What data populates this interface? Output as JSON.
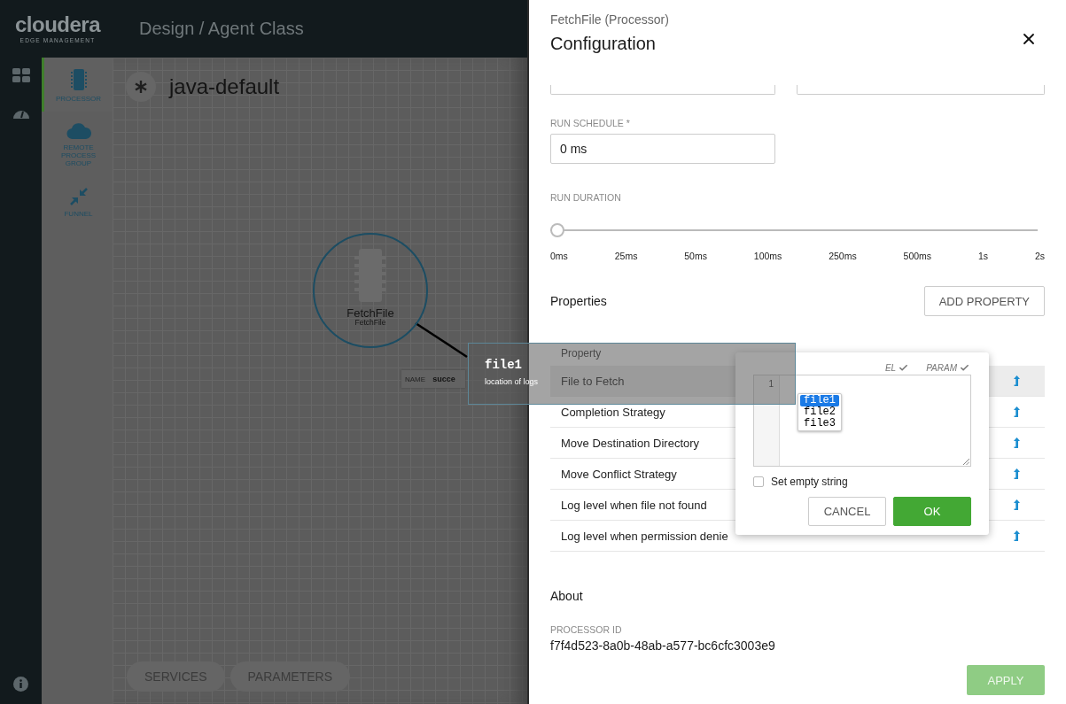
{
  "app": {
    "logo": "cloudera",
    "logo_sub": "EDGE MANAGEMENT",
    "breadcrumb": "Design / Agent Class"
  },
  "palette": [
    {
      "kind": "processor",
      "label": "PROCESSOR",
      "selected": true
    },
    {
      "kind": "remote",
      "label": "REMOTE PROCESS GROUP",
      "selected": false
    },
    {
      "kind": "funnel",
      "label": "FUNNEL",
      "selected": false
    }
  ],
  "flow": {
    "name": "java-default"
  },
  "node": {
    "name": "FetchFile",
    "type": "FetchFile"
  },
  "connection": {
    "label": "NAME",
    "name": "succe"
  },
  "canvas_buttons": [
    "SERVICES",
    "PARAMETERS"
  ],
  "tooltip": {
    "title": "file1",
    "description": "location of logs"
  },
  "panel": {
    "subtitle": "FetchFile (Processor)",
    "title": "Configuration",
    "run_schedule": {
      "label": "RUN SCHEDULE *",
      "value": "0 ms"
    },
    "run_duration": {
      "label": "RUN DURATION",
      "level": 0,
      "ticks": [
        "0ms",
        "25ms",
        "50ms",
        "100ms",
        "250ms",
        "500ms",
        "1s",
        "2s"
      ]
    },
    "properties": {
      "title": "Properties",
      "add_button": "ADD PROPERTY",
      "columns": [
        "Property"
      ],
      "rows": [
        {
          "name": "File to Fetch",
          "selected": true
        },
        {
          "name": "Completion Strategy",
          "selected": false
        },
        {
          "name": "Move Destination Directory",
          "selected": false
        },
        {
          "name": "Move Conflict Strategy",
          "selected": false
        },
        {
          "name": "Log level when file not found",
          "selected": false
        },
        {
          "name": "Log level when permission denie",
          "selected": false
        }
      ]
    },
    "about": {
      "title": "About",
      "id_label": "PROCESSOR ID",
      "id": "f7f4d523-8a0b-48ab-a577-bc6cfc3003e9"
    },
    "apply": "APPLY"
  },
  "editor": {
    "flags": [
      {
        "label": "EL",
        "checked": true
      },
      {
        "label": "PARAM",
        "checked": true
      }
    ],
    "line_numbers": [
      "1"
    ],
    "suggestions": [
      {
        "text": "file1",
        "selected": true
      },
      {
        "text": "file2",
        "selected": false
      },
      {
        "text": "file3",
        "selected": false
      }
    ],
    "empty_string": {
      "label": "Set empty string",
      "checked": false
    },
    "buttons": [
      {
        "label": "CANCEL",
        "kind": "secondary"
      },
      {
        "label": "OK",
        "kind": "primary"
      }
    ]
  }
}
